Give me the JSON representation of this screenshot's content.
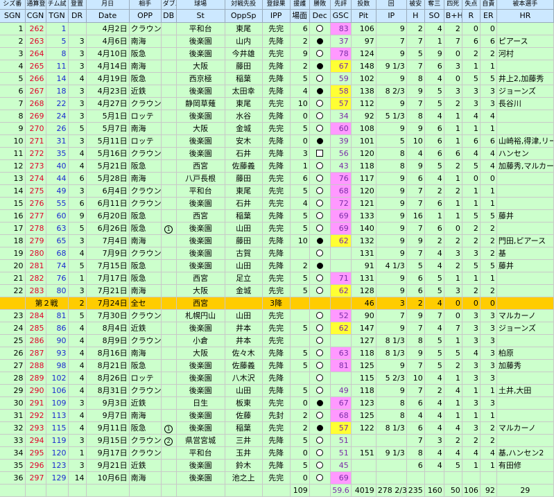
{
  "headers_jp": [
    "シズ番",
    "通算登",
    "チム試",
    "登置",
    "月日",
    "相手",
    "ダブル",
    "球場",
    "対戦先投",
    "登録果",
    "援護",
    "勝敗",
    "先評",
    "投数",
    "回",
    "",
    "被安",
    "奪三",
    "四死",
    "失点",
    "自責",
    "被本選手"
  ],
  "headers_en": [
    "SGN",
    "CGN",
    "TGN",
    "DR",
    "Date",
    "OPP",
    "DB",
    "St",
    "OppSp",
    "IPP",
    "場面",
    "Dec",
    "GSC",
    "Pit",
    "IP",
    "H",
    "SO",
    "B+H",
    "R",
    "ER",
    "HR"
  ],
  "rows": [
    {
      "sgn": "1",
      "cgn": "262",
      "tgn": "1",
      "dr": "",
      "date": "4月2日",
      "opp": "クラウン",
      "db": "",
      "st": "平和台",
      "oppsp": "東尾",
      "ipp": "先完",
      "sup": "6",
      "dec": "L",
      "gsc": "83",
      "gc": "pink",
      "pit": "106",
      "ip": "9",
      "h": "2",
      "so": "4",
      "bh": "2",
      "r": "0",
      "er": "0",
      "hr": ""
    },
    {
      "sgn": "2",
      "cgn": "263",
      "tgn": "5",
      "dr": "3",
      "date": "4月6日",
      "opp": "南海",
      "db": "",
      "st": "後楽園",
      "oppsp": "山内",
      "ipp": "先降",
      "sup": "2",
      "dec": "W",
      "gsc": "37",
      "gc": "",
      "pit": "97",
      "ip": "7",
      "h": "7",
      "so": "1",
      "bh": "7",
      "r": "6",
      "er": "6",
      "hr": "ピアース"
    },
    {
      "sgn": "3",
      "cgn": "264",
      "tgn": "8",
      "dr": "3",
      "date": "4月10日",
      "opp": "阪急",
      "db": "",
      "st": "後楽園",
      "oppsp": "今井雄",
      "ipp": "先完",
      "sup": "9",
      "dec": "L",
      "gsc": "78",
      "gc": "pink",
      "pit": "124",
      "ip": "9",
      "h": "5",
      "so": "9",
      "bh": "0",
      "r": "2",
      "er": "2",
      "hr": "河村"
    },
    {
      "sgn": "4",
      "cgn": "265",
      "tgn": "11",
      "dr": "3",
      "date": "4月14日",
      "opp": "南海",
      "db": "",
      "st": "大阪",
      "oppsp": "藤田",
      "ipp": "先降",
      "sup": "2",
      "dec": "W",
      "gsc": "67",
      "gc": "yellow",
      "pit": "148",
      "ip": "9 1/3",
      "h": "7",
      "so": "6",
      "bh": "3",
      "r": "1",
      "er": "1",
      "hr": ""
    },
    {
      "sgn": "5",
      "cgn": "266",
      "tgn": "14",
      "dr": "4",
      "date": "4月19日",
      "opp": "阪急",
      "db": "",
      "st": "西京極",
      "oppsp": "稲葉",
      "ipp": "先降",
      "sup": "5",
      "dec": "L",
      "gsc": "59",
      "gc": "",
      "pit": "102",
      "ip": "9",
      "h": "8",
      "so": "4",
      "bh": "0",
      "r": "5",
      "er": "5",
      "hr": "井上2,加藤秀"
    },
    {
      "sgn": "6",
      "cgn": "267",
      "tgn": "18",
      "dr": "3",
      "date": "4月23日",
      "opp": "近鉄",
      "db": "",
      "st": "後楽園",
      "oppsp": "太田幸",
      "ipp": "先降",
      "sup": "4",
      "dec": "W",
      "gsc": "58",
      "gc": "yellow",
      "pit": "138",
      "ip": "8 2/3",
      "h": "9",
      "so": "5",
      "bh": "3",
      "r": "3",
      "er": "3",
      "hr": "ジョーンズ"
    },
    {
      "sgn": "7",
      "cgn": "268",
      "tgn": "22",
      "dr": "3",
      "date": "4月27日",
      "opp": "クラウン",
      "db": "",
      "st": "静岡草薙",
      "oppsp": "東尾",
      "ipp": "先完",
      "sup": "10",
      "dec": "L",
      "gsc": "57",
      "gc": "yellow",
      "pit": "112",
      "ip": "9",
      "h": "7",
      "so": "5",
      "bh": "2",
      "r": "3",
      "er": "3",
      "hr": "長谷川"
    },
    {
      "sgn": "8",
      "cgn": "269",
      "tgn": "24",
      "dr": "3",
      "date": "5月1日",
      "opp": "ロッテ",
      "db": "",
      "st": "後楽園",
      "oppsp": "水谷",
      "ipp": "先降",
      "sup": "0",
      "dec": "L",
      "gsc": "34",
      "gc": "",
      "pit": "92",
      "ip": "5 1/3",
      "h": "8",
      "so": "4",
      "bh": "1",
      "r": "4",
      "er": "4",
      "hr": ""
    },
    {
      "sgn": "9",
      "cgn": "270",
      "tgn": "26",
      "dr": "5",
      "date": "5月7日",
      "opp": "南海",
      "db": "",
      "st": "大阪",
      "oppsp": "金城",
      "ipp": "先完",
      "sup": "5",
      "dec": "L",
      "gsc": "60",
      "gc": "pink",
      "pit": "108",
      "ip": "9",
      "h": "9",
      "so": "6",
      "bh": "1",
      "r": "1",
      "er": "1",
      "hr": ""
    },
    {
      "sgn": "10",
      "cgn": "271",
      "tgn": "31",
      "dr": "3",
      "date": "5月11日",
      "opp": "ロッテ",
      "db": "",
      "st": "後楽園",
      "oppsp": "安木",
      "ipp": "先降",
      "sup": "0",
      "dec": "W",
      "gsc": "39",
      "gc": "",
      "pit": "101",
      "ip": "5",
      "h": "10",
      "so": "6",
      "bh": "1",
      "r": "6",
      "er": "6",
      "hr": "山崎裕,得津,リー"
    },
    {
      "sgn": "11",
      "cgn": "272",
      "tgn": "35",
      "dr": "4",
      "date": "5月16日",
      "opp": "クラウン",
      "db": "",
      "st": "後楽園",
      "oppsp": "石井",
      "ipp": "先降",
      "sup": "3",
      "dec": "D",
      "gsc": "56",
      "gc": "",
      "pit": "120",
      "ip": "8",
      "h": "4",
      "so": "6",
      "bh": "6",
      "r": "4",
      "er": "4",
      "hr": "ハンセン"
    },
    {
      "sgn": "12",
      "cgn": "273",
      "tgn": "40",
      "dr": "4",
      "date": "5月21日",
      "opp": "阪急",
      "db": "",
      "st": "西宮",
      "oppsp": "佐藤義",
      "ipp": "先降",
      "sup": "1",
      "dec": "L",
      "gsc": "43",
      "gc": "",
      "pit": "118",
      "ip": "8",
      "h": "9",
      "so": "5",
      "bh": "2",
      "r": "5",
      "er": "4",
      "hr": "加藤秀,マルカーノ"
    },
    {
      "sgn": "13",
      "cgn": "274",
      "tgn": "44",
      "dr": "6",
      "date": "5月28日",
      "opp": "南海",
      "db": "",
      "st": "八戸長根",
      "oppsp": "藤田",
      "ipp": "先完",
      "sup": "6",
      "dec": "L",
      "gsc": "76",
      "gc": "pink",
      "pit": "117",
      "ip": "9",
      "h": "6",
      "so": "4",
      "bh": "1",
      "r": "0",
      "er": "0",
      "hr": ""
    },
    {
      "sgn": "14",
      "cgn": "275",
      "tgn": "49",
      "dr": "3",
      "date": "6月4日",
      "opp": "クラウン",
      "db": "",
      "st": "平和台",
      "oppsp": "東尾",
      "ipp": "先完",
      "sup": "5",
      "dec": "L",
      "gsc": "68",
      "gc": "pink",
      "pit": "120",
      "ip": "9",
      "h": "7",
      "so": "2",
      "bh": "2",
      "r": "1",
      "er": "1",
      "hr": ""
    },
    {
      "sgn": "15",
      "cgn": "276",
      "tgn": "55",
      "dr": "6",
      "date": "6月11日",
      "opp": "クラウン",
      "db": "",
      "st": "後楽園",
      "oppsp": "石井",
      "ipp": "先完",
      "sup": "4",
      "dec": "L",
      "gsc": "72",
      "gc": "pink",
      "pit": "121",
      "ip": "9",
      "h": "7",
      "so": "6",
      "bh": "1",
      "r": "1",
      "er": "1",
      "hr": ""
    },
    {
      "sgn": "16",
      "cgn": "277",
      "tgn": "60",
      "dr": "9",
      "date": "6月20日",
      "opp": "阪急",
      "db": "",
      "st": "西宮",
      "oppsp": "稲葉",
      "ipp": "先降",
      "sup": "5",
      "dec": "L",
      "gsc": "69",
      "gc": "pink",
      "pit": "133",
      "ip": "9",
      "h": "16",
      "so": "1",
      "bh": "1",
      "r": "5",
      "er": "5",
      "hr": "藤井"
    },
    {
      "sgn": "17",
      "cgn": "278",
      "tgn": "63",
      "dr": "5",
      "date": "6月26日",
      "opp": "阪急",
      "db": "1",
      "st": "後楽園",
      "oppsp": "山田",
      "ipp": "先完",
      "sup": "5",
      "dec": "L",
      "gsc": "69",
      "gc": "pink",
      "pit": "140",
      "ip": "9",
      "h": "7",
      "so": "6",
      "bh": "0",
      "r": "2",
      "er": "2",
      "hr": ""
    },
    {
      "sgn": "18",
      "cgn": "279",
      "tgn": "65",
      "dr": "3",
      "date": "7月4日",
      "opp": "南海",
      "db": "",
      "st": "後楽園",
      "oppsp": "藤田",
      "ipp": "先降",
      "sup": "10",
      "dec": "W",
      "gsc": "62",
      "gc": "yellow",
      "pit": "132",
      "ip": "9",
      "h": "9",
      "so": "2",
      "bh": "2",
      "r": "2",
      "er": "2",
      "hr": "門田,ピアース"
    },
    {
      "sgn": "19",
      "cgn": "280",
      "tgn": "68",
      "dr": "4",
      "date": "7月9日",
      "opp": "クラウン",
      "db": "",
      "st": "後楽園",
      "oppsp": "古賀",
      "ipp": "先降",
      "sup": "",
      "dec": "L",
      "gsc": "",
      "gc": "",
      "pit": "131",
      "ip": "9",
      "h": "7",
      "so": "4",
      "bh": "3",
      "r": "3",
      "er": "2",
      "hr": "基"
    },
    {
      "sgn": "20",
      "cgn": "281",
      "tgn": "74",
      "dr": "5",
      "date": "7月15日",
      "opp": "阪急",
      "db": "",
      "st": "後楽園",
      "oppsp": "山田",
      "ipp": "先降",
      "sup": "2",
      "dec": "W",
      "gsc": "",
      "gc": "",
      "pit": "91",
      "ip": "4 1/3",
      "h": "5",
      "so": "4",
      "bh": "2",
      "r": "5",
      "er": "5",
      "hr": "藤井"
    },
    {
      "sgn": "21",
      "cgn": "282",
      "tgn": "76",
      "dr": "1",
      "date": "7月17日",
      "opp": "阪急",
      "db": "",
      "st": "西宮",
      "oppsp": "足立",
      "ipp": "先完",
      "sup": "5",
      "dec": "L",
      "gsc": "71",
      "gc": "pink",
      "pit": "131",
      "ip": "9",
      "h": "6",
      "so": "5",
      "bh": "1",
      "r": "1",
      "er": "1",
      "hr": ""
    },
    {
      "sgn": "22",
      "cgn": "283",
      "tgn": "80",
      "dr": "3",
      "date": "7月21日",
      "opp": "南海",
      "db": "",
      "st": "大阪",
      "oppsp": "金城",
      "ipp": "先完",
      "sup": "5",
      "dec": "L",
      "gsc": "62",
      "gc": "yellow",
      "pit": "128",
      "ip": "9",
      "h": "6",
      "so": "5",
      "bh": "3",
      "r": "2",
      "er": "2",
      "hr": ""
    }
  ],
  "special": {
    "label": "第２戦",
    "dr": "2",
    "date": "7月24日",
    "opp": "全セ",
    "st": "西宮",
    "ipp": "3降",
    "pit": "46",
    "ip": "3",
    "h": "2",
    "so": "4",
    "bh": "0",
    "r": "0",
    "er": "0"
  },
  "rows2": [
    {
      "sgn": "23",
      "cgn": "284",
      "tgn": "81",
      "dr": "5",
      "date": "7月30日",
      "opp": "クラウン",
      "db": "",
      "st": "札幌円山",
      "oppsp": "山田",
      "ipp": "先完",
      "sup": "",
      "dec": "L",
      "gsc": "52",
      "gc": "pink",
      "pit": "90",
      "ip": "7",
      "h": "9",
      "so": "7",
      "bh": "0",
      "r": "3",
      "er": "3",
      "hr": "マルカーノ"
    },
    {
      "sgn": "24",
      "cgn": "285",
      "tgn": "86",
      "dr": "4",
      "date": "8月4日",
      "opp": "近鉄",
      "db": "",
      "st": "後楽園",
      "oppsp": "井本",
      "ipp": "先完",
      "sup": "5",
      "dec": "L",
      "gsc": "62",
      "gc": "yellow",
      "pit": "147",
      "ip": "9",
      "h": "7",
      "so": "4",
      "bh": "7",
      "r": "3",
      "er": "3",
      "hr": "ジョーンズ"
    },
    {
      "sgn": "25",
      "cgn": "286",
      "tgn": "90",
      "dr": "4",
      "date": "8月9日",
      "opp": "クラウン",
      "db": "",
      "st": "小倉",
      "oppsp": "井本",
      "ipp": "先完",
      "sup": "",
      "dec": "L",
      "gsc": "",
      "gc": "",
      "pit": "127",
      "ip": "8 1/3",
      "h": "8",
      "so": "5",
      "bh": "1",
      "r": "3",
      "er": "3",
      "hr": ""
    },
    {
      "sgn": "26",
      "cgn": "287",
      "tgn": "93",
      "dr": "4",
      "date": "8月16日",
      "opp": "南海",
      "db": "",
      "st": "大阪",
      "oppsp": "佐々木",
      "ipp": "先降",
      "sup": "5",
      "dec": "L",
      "gsc": "63",
      "gc": "pink",
      "pit": "118",
      "ip": "8 1/3",
      "h": "9",
      "so": "5",
      "bh": "5",
      "r": "4",
      "er": "3",
      "hr": "柏原"
    },
    {
      "sgn": "27",
      "cgn": "288",
      "tgn": "98",
      "dr": "4",
      "date": "8月21日",
      "opp": "阪急",
      "db": "",
      "st": "後楽園",
      "oppsp": "佐藤義",
      "ipp": "先降",
      "sup": "5",
      "dec": "L",
      "gsc": "81",
      "gc": "pink",
      "pit": "125",
      "ip": "9",
      "h": "7",
      "so": "5",
      "bh": "2",
      "r": "3",
      "er": "3",
      "hr": "加藤秀"
    },
    {
      "sgn": "28",
      "cgn": "289",
      "tgn": "102",
      "dr": "4",
      "date": "8月26日",
      "opp": "ロッテ",
      "db": "",
      "st": "後楽園",
      "oppsp": "八木沢",
      "ipp": "先降",
      "sup": "",
      "dec": "L",
      "gsc": "",
      "gc": "",
      "pit": "115",
      "ip": "5 2/3",
      "h": "10",
      "so": "4",
      "bh": "1",
      "r": "3",
      "er": "3",
      "hr": ""
    },
    {
      "sgn": "29",
      "cgn": "290",
      "tgn": "106",
      "dr": "4",
      "date": "8月31日",
      "opp": "クラウン",
      "db": "",
      "st": "後楽園",
      "oppsp": "山田",
      "ipp": "先降",
      "sup": "5",
      "dec": "L",
      "gsc": "49",
      "gc": "",
      "pit": "118",
      "ip": "9",
      "h": "7",
      "so": "2",
      "bh": "4",
      "r": "1",
      "er": "1",
      "hr": "土井,大田"
    },
    {
      "sgn": "30",
      "cgn": "291",
      "tgn": "109",
      "dr": "3",
      "date": "9月3日",
      "opp": "近鉄",
      "db": "",
      "st": "日生",
      "oppsp": "板東",
      "ipp": "先完",
      "sup": "0",
      "dec": "W",
      "gsc": "67",
      "gc": "pink",
      "pit": "123",
      "ip": "8",
      "h": "6",
      "so": "4",
      "bh": "1",
      "r": "3",
      "er": "3",
      "hr": ""
    },
    {
      "sgn": "31",
      "cgn": "292",
      "tgn": "113",
      "dr": "4",
      "date": "9月7日",
      "opp": "南海",
      "db": "",
      "st": "後楽園",
      "oppsp": "佐藤",
      "ipp": "先封",
      "sup": "2",
      "dec": "L",
      "gsc": "68",
      "gc": "pink",
      "pit": "125",
      "ip": "8",
      "h": "4",
      "so": "4",
      "bh": "1",
      "r": "1",
      "er": "1",
      "hr": ""
    },
    {
      "sgn": "32",
      "cgn": "293",
      "tgn": "115",
      "dr": "4",
      "date": "9月11日",
      "opp": "阪急",
      "db": "1",
      "st": "後楽園",
      "oppsp": "稲葉",
      "ipp": "先完",
      "sup": "2",
      "dec": "W",
      "gsc": "57",
      "gc": "yellow",
      "pit": "122",
      "ip": "8 1/3",
      "h": "6",
      "so": "4",
      "bh": "4",
      "r": "3",
      "er": "2",
      "hr": "マルカーノ"
    },
    {
      "sgn": "33",
      "cgn": "294",
      "tgn": "119",
      "dr": "3",
      "date": "9月15日",
      "opp": "クラウン",
      "db": "2",
      "st": "県営宮城",
      "oppsp": "三井",
      "ipp": "先降",
      "sup": "5",
      "dec": "L",
      "gsc": "51",
      "gc": "",
      "pit": "",
      "ip": "",
      "h": "7",
      "so": "3",
      "bh": "2",
      "r": "2",
      "er": "2",
      "hr": ""
    },
    {
      "sgn": "34",
      "cgn": "295",
      "tgn": "120",
      "dr": "1",
      "date": "9月17日",
      "opp": "クラウン",
      "db": "",
      "st": "平和台",
      "oppsp": "玉井",
      "ipp": "先降",
      "sup": "0",
      "dec": "L",
      "gsc": "51",
      "gc": "",
      "pit": "151",
      "ip": "9 1/3",
      "h": "8",
      "so": "4",
      "bh": "4",
      "r": "4",
      "er": "4",
      "hr": "基,ハンセン2"
    },
    {
      "sgn": "35",
      "cgn": "296",
      "tgn": "123",
      "dr": "3",
      "date": "9月21日",
      "opp": "近鉄",
      "db": "",
      "st": "後楽園",
      "oppsp": "鈴木",
      "ipp": "先降",
      "sup": "5",
      "dec": "L",
      "gsc": "45",
      "gc": "",
      "pit": "",
      "ip": "",
      "h": "6",
      "so": "4",
      "bh": "5",
      "r": "1",
      "er": "1",
      "hr": "有田修"
    },
    {
      "sgn": "36",
      "cgn": "297",
      "tgn": "129",
      "dr": "14",
      "date": "10月6日",
      "opp": "南海",
      "db": "",
      "st": "後楽園",
      "oppsp": "池之上",
      "ipp": "先完",
      "sup": "0",
      "dec": "L",
      "gsc": "69",
      "gc": "pink",
      "pit": "",
      "ip": "",
      "h": "",
      "so": "",
      "bh": "",
      "r": "",
      "er": "",
      "hr": ""
    }
  ],
  "totals": {
    "sup": "109",
    "gsc": "59.6",
    "pit": "4019",
    "ip": "278 2/3",
    "h": "235",
    "so": "160",
    "bh": "50",
    "r": "106",
    "er": "92",
    "hr": "29"
  }
}
